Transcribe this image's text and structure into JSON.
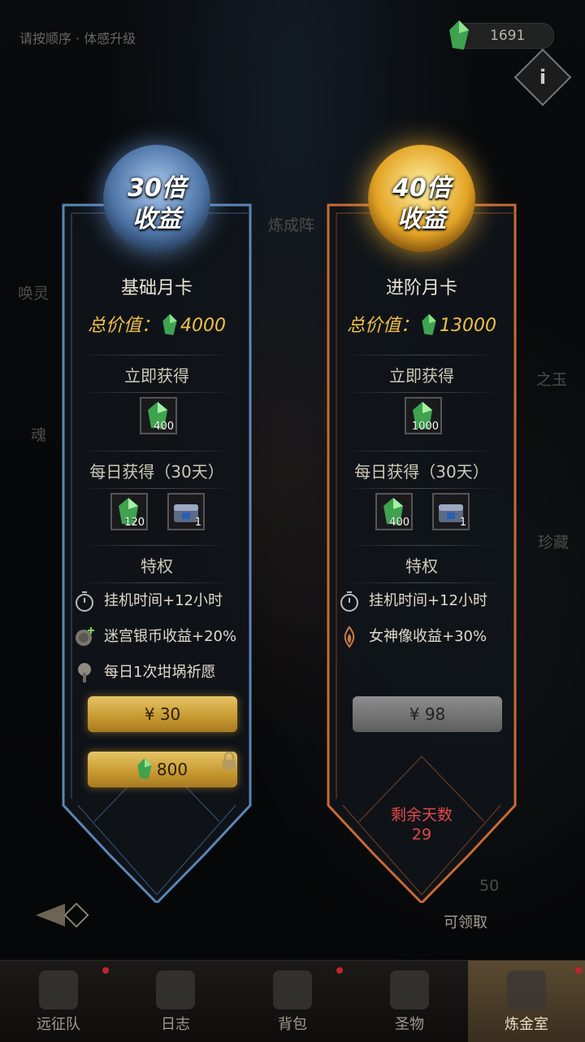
{
  "topbar": {
    "hint": "请按顺序 · 体感升级",
    "gem_count": "1691",
    "info_icon": "info-icon"
  },
  "background_labels": {
    "left1": "唤灵",
    "left2": "魂",
    "center": "炼成阵",
    "right1": "之玉",
    "right2": "珍藏",
    "claim": "可领取",
    "num": "50"
  },
  "cards": {
    "basic": {
      "badge_line1": "30倍",
      "badge_line2": "收益",
      "title": "基础月卡",
      "total_label": "总价值：",
      "total_value": "4000",
      "instant_label": "立即获得",
      "instant_item_count": "400",
      "daily_label": "每日获得（30天）",
      "daily_gem_count": "120",
      "daily_chest_count": "1",
      "perks_label": "特权",
      "perks": [
        "挂机时间+12小时",
        "迷宫银币收益+20%",
        "每日1次坩埚祈愿"
      ],
      "price": "¥ 30",
      "gem_price": "800"
    },
    "adv": {
      "badge_line1": "40倍",
      "badge_line2": "收益",
      "title": "进阶月卡",
      "total_label": "总价值：",
      "total_value": "13000",
      "instant_label": "立即获得",
      "instant_item_count": "1000",
      "daily_label": "每日获得（30天）",
      "daily_gem_count": "400",
      "daily_chest_count": "1",
      "perks_label": "特权",
      "perks": [
        "挂机时间+12小时",
        "女神像收益+30%"
      ],
      "price": "¥ 98",
      "days_label": "剩余天数",
      "days_value": "29"
    }
  },
  "nav": [
    "远征队",
    "日志",
    "背包",
    "圣物",
    "炼金室"
  ],
  "colors": {
    "gold": "#f0c04a",
    "blue_frame": "#5b86b5",
    "orange_frame": "#c96a35",
    "red": "#e24a4a"
  }
}
